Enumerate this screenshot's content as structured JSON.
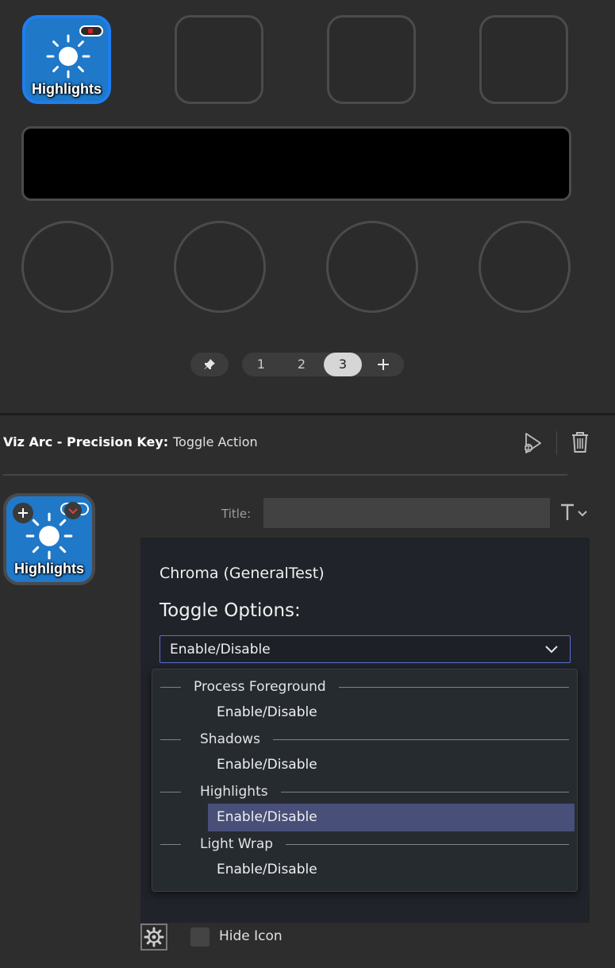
{
  "keys": [
    {
      "label": "Highlights",
      "icon": "sun-icon",
      "active": true
    },
    {
      "label": "",
      "active": false
    },
    {
      "label": "",
      "active": false
    },
    {
      "label": "",
      "active": false
    }
  ],
  "pages": {
    "items": [
      "1",
      "2",
      "3"
    ],
    "current": "3",
    "add_icon": "plus-icon",
    "pin_icon": "pin-icon"
  },
  "header": {
    "plugin_name": "Viz Arc - Precision Key:",
    "action_name": "Toggle Action",
    "test_icon": "play-debug-icon",
    "delete_icon": "trash-icon"
  },
  "preview": {
    "label": "Highlights",
    "icon": "sun-icon"
  },
  "title_field": {
    "label": "Title:",
    "value": "",
    "tool_icon": "text-format-icon"
  },
  "panel": {
    "heading": "Chroma (GeneralTest)",
    "options_label": "Toggle Options:",
    "selected_value": "Enable/Disable",
    "groups": [
      {
        "name": "Process Foreground",
        "options": [
          "Enable/Disable"
        ]
      },
      {
        "name": "Shadows",
        "options": [
          "Enable/Disable"
        ]
      },
      {
        "name": "Highlights",
        "options": [
          "Enable/Disable"
        ],
        "selected": true
      },
      {
        "name": "Light Wrap",
        "options": [
          "Enable/Disable"
        ]
      }
    ]
  },
  "footer": {
    "settings_icon": "gear-icon",
    "hide_icon_label": "Hide Icon",
    "hide_icon_checked": false
  },
  "colors": {
    "accent": "#1e7ef0",
    "key_blue": "#1f78c8",
    "select_border": "#5b6fd6",
    "selected_option": "#484f78"
  }
}
